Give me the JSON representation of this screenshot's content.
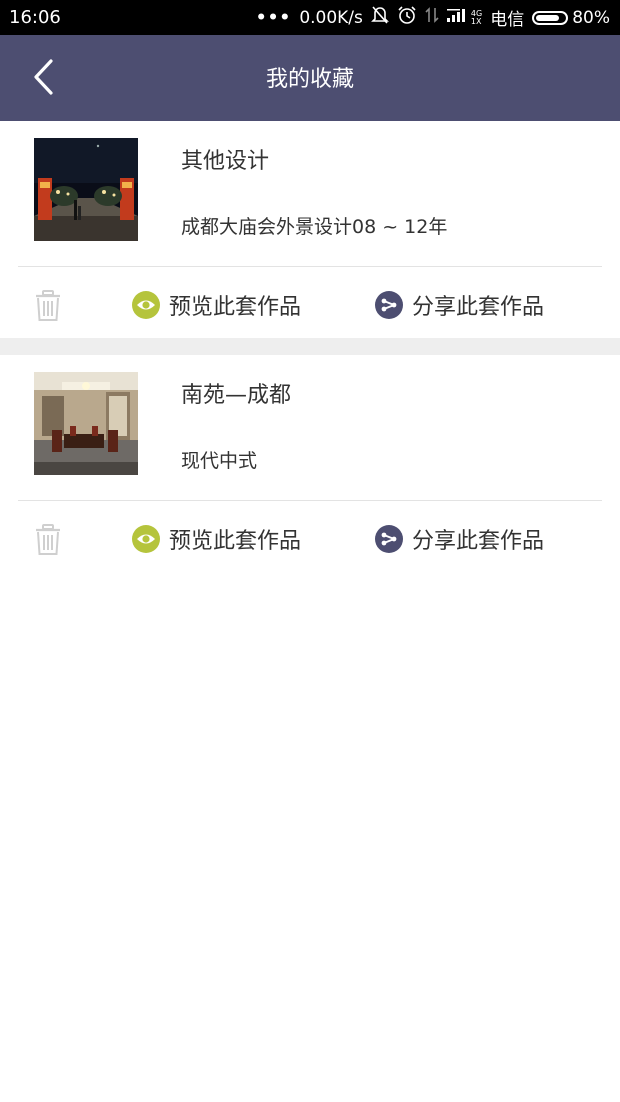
{
  "status_bar": {
    "time": "16:06",
    "dots": "•••",
    "net_speed": "0.00K/s",
    "net_type_top": "4G",
    "net_type_bottom": "1X",
    "carrier": "电信",
    "battery": "80%",
    "battery_level": 0.8,
    "icons": [
      "mute-bell-icon",
      "alarm-clock-icon",
      "data-arrows-icon",
      "signal-icon"
    ]
  },
  "header": {
    "title": "我的收藏",
    "back_icon": "chevron-left-icon",
    "background": "#4d4e71"
  },
  "favorites": [
    {
      "title": "其他设计",
      "subtitle": "成都大庙会外景设计08 ~ 12年",
      "thumbnail": "night-temple-fair-scene",
      "actions": {
        "preview": "预览此套作品",
        "share": "分享此套作品"
      }
    },
    {
      "title": "南苑—成都",
      "subtitle": "现代中式",
      "thumbnail": "chinese-style-interior-scene",
      "actions": {
        "preview": "预览此套作品",
        "share": "分享此套作品"
      }
    }
  ],
  "icons": {
    "delete": "trash-icon",
    "preview": "eye-icon",
    "share": "share-icon"
  },
  "colors": {
    "header": "#4d4e71",
    "preview_icon": "#b5c43c",
    "share_icon": "#4d4e71",
    "trash_icon": "#cfcfcf"
  }
}
